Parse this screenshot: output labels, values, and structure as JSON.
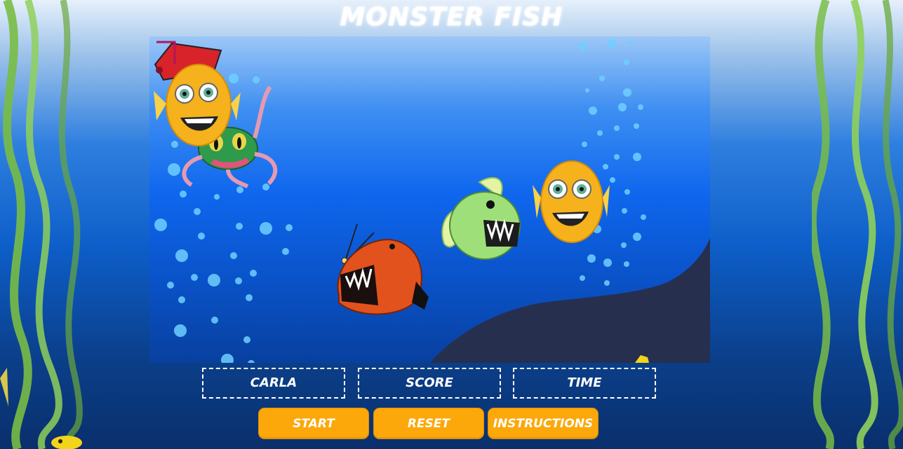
{
  "page": {
    "title": "MONSTER FISH"
  },
  "stats": {
    "player_name": "CARLA",
    "score_label": "SCORE",
    "time_label": "TIME"
  },
  "controls": {
    "start_label": "START",
    "reset_label": "RESET",
    "instructions_label": "INSTRUCTIONS"
  },
  "sprites": {
    "icons": [
      "goldfish-icon",
      "octopus-icon",
      "anglerfish-icon",
      "piranha-icon",
      "pirate-hat-icon",
      "seaweed-icon",
      "bubble-icon",
      "rock-icon",
      "starfish-icon"
    ]
  },
  "colors": {
    "button": "#fca80a",
    "stat_border": "#ffffff",
    "water_top": "#9cc7f7",
    "water_bottom": "#08409f",
    "rock": "#272f4f",
    "seaweed": "#7cc24a"
  }
}
